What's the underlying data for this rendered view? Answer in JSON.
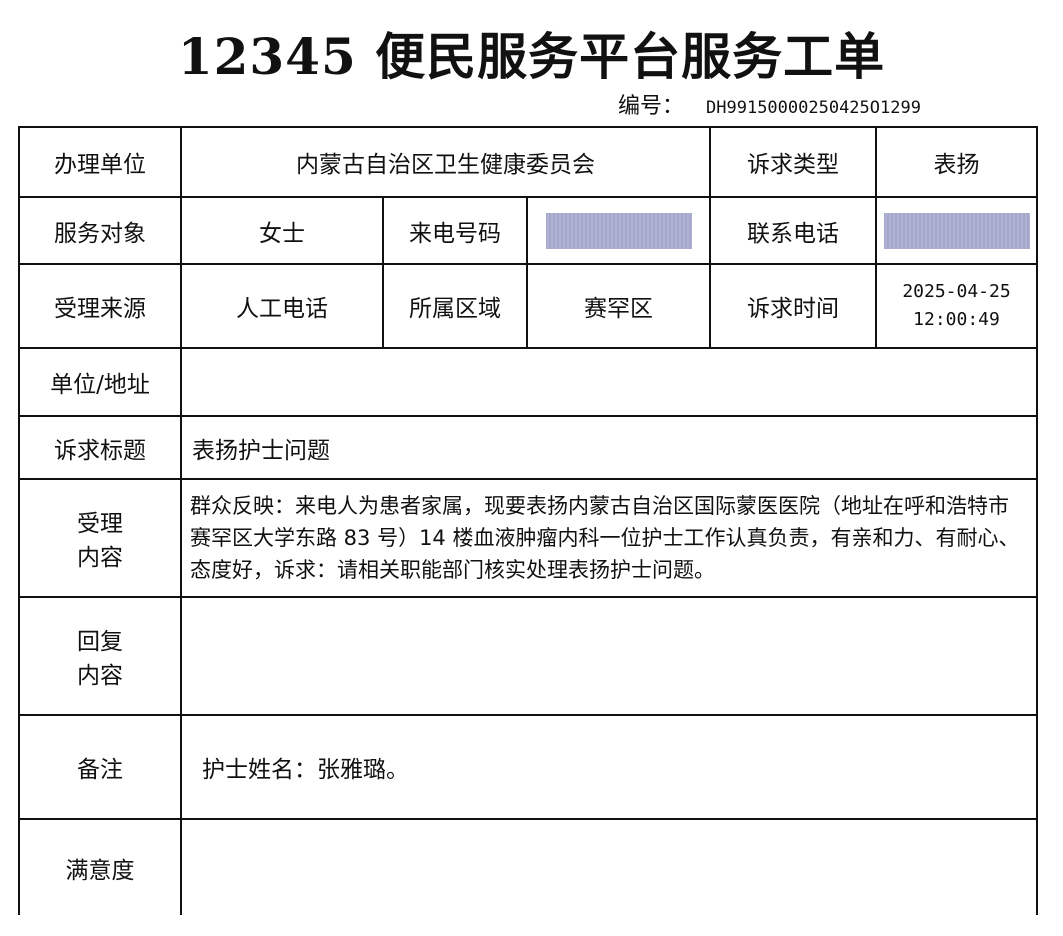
{
  "header": {
    "title": "12345 便民服务平台服务工单",
    "serial_label": "编号：",
    "serial_value": "DH99150000250425O1299"
  },
  "rows": {
    "unit_label": "办理单位",
    "unit_value": "内蒙古自治区卫生健康委员会",
    "type_label": "诉求类型",
    "type_value": "表扬",
    "client_label": "服务对象",
    "client_value": "女士",
    "caller_label": "来电号码",
    "contact_label": "联系电话",
    "source_label": "受理来源",
    "source_value": "人工电话",
    "region_label": "所属区域",
    "region_value": "赛罕区",
    "time_label": "诉求时间",
    "time_date": "2025-04-25",
    "time_clock": "12:00:49",
    "address_label": "单位/地址",
    "subject_label": "诉求标题",
    "subject_value": "表扬护士问题",
    "content_label_1": "受理",
    "content_label_2": "内容",
    "content_value": "群众反映：来电人为患者家属，现要表扬内蒙古自治区国际蒙医医院（地址在呼和浩特市赛罕区大学东路 83 号）14 楼血液肿瘤内科一位护士工作认真负责，有亲和力、有耐心、态度好，诉求：请相关职能部门核实处理表扬护士问题。",
    "reply_label_1": "回复",
    "reply_label_2": "内容",
    "remark_label": "备注",
    "remark_value": "护士姓名：张雅璐。",
    "satisfaction_label": "满意度"
  }
}
